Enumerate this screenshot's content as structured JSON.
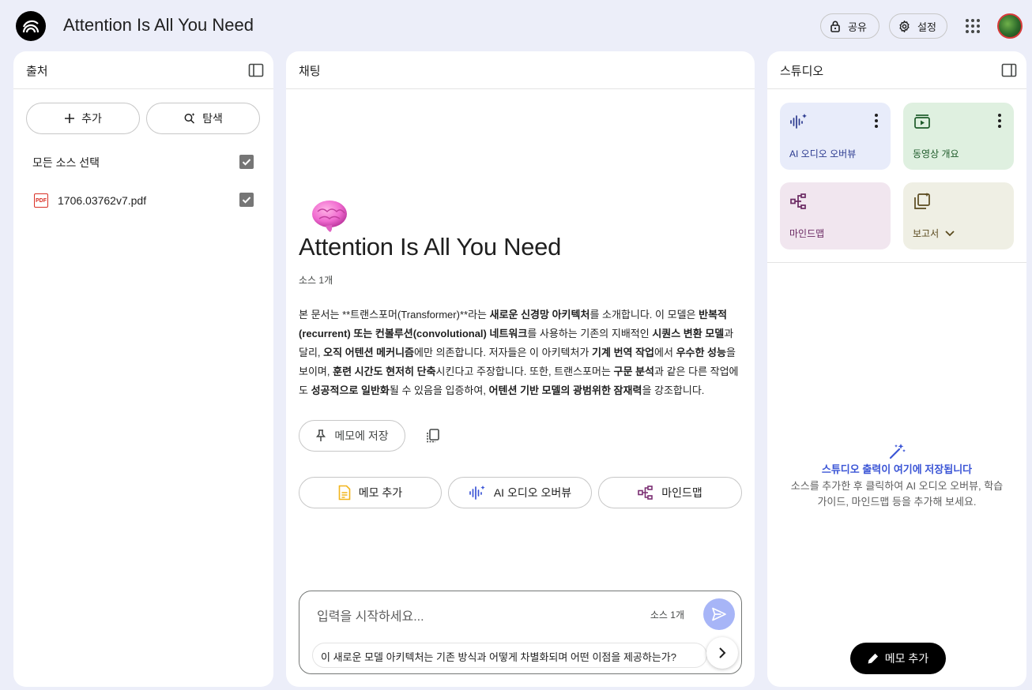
{
  "app": {
    "title": "Attention Is All You Need"
  },
  "header": {
    "share_label": "공유",
    "settings_label": "설정"
  },
  "sources": {
    "title": "출처",
    "add_label": "추가",
    "discover_label": "탐색",
    "select_all_label": "모든 소스 선택",
    "select_all_checked": true,
    "files": [
      {
        "name": "1706.03762v7.pdf",
        "icon": "pdf-icon",
        "checked": true
      }
    ]
  },
  "chat": {
    "title": "채팅",
    "doc_title": "Attention Is All You Need",
    "source_count": "소스 1개",
    "summary": [
      {
        "t": "본 문서는 **트랜스포머(Transformer)**라는 ",
        "b": false
      },
      {
        "t": "새로운 신경망 아키텍처",
        "b": true
      },
      {
        "t": "를 소개합니다. 이 모델은 ",
        "b": false
      },
      {
        "t": "반복적 (recurrent) 또는 컨볼루션(convolutional) 네트워크",
        "b": true
      },
      {
        "t": "를 사용하는 기존의 지배적인 ",
        "b": false
      },
      {
        "t": "시퀀스 변환 모델",
        "b": true
      },
      {
        "t": "과 달리, ",
        "b": false
      },
      {
        "t": "오직 어텐션 메커니즘",
        "b": true
      },
      {
        "t": "에만 의존합니다. 저자들은 이 아키텍처가 ",
        "b": false
      },
      {
        "t": "기계 번역 작업",
        "b": true
      },
      {
        "t": "에서 ",
        "b": false
      },
      {
        "t": "우수한 성능",
        "b": true
      },
      {
        "t": "을 보이며, ",
        "b": false
      },
      {
        "t": "훈련 시간도 현저히 단축",
        "b": true
      },
      {
        "t": "시킨다고 주장합니다. 또한, 트랜스포머는 ",
        "b": false
      },
      {
        "t": "구문 분석",
        "b": true
      },
      {
        "t": "과 같은 다른 작업에도 ",
        "b": false
      },
      {
        "t": "성공적으로 일반화",
        "b": true
      },
      {
        "t": "될 수 있음을 입증하여, ",
        "b": false
      },
      {
        "t": "어텐션 기반 모델의 광범위한 잠재력",
        "b": true
      },
      {
        "t": "을 강조합니다.",
        "b": false
      }
    ],
    "save_memo_label": "메모에 저장",
    "actions": {
      "memo": "메모 추가",
      "audio": "AI 오디오 오버뷰",
      "mindmap": "마인드맵"
    },
    "input": {
      "placeholder": "입력을 시작하세요...",
      "source_count": "소스 1개",
      "suggestion": "이 새로운 모델 아키텍처는 기존 방식과 어떻게 차별화되며 어떤 이점을 제공하는가?"
    }
  },
  "studio": {
    "title": "스튜디오",
    "tiles": {
      "audio": "AI 오디오 오버뷰",
      "video": "동영상 개요",
      "mindmap": "마인드맵",
      "report": "보고서"
    },
    "empty_title": "스튜디오 출력이 여기에 저장됩니다",
    "empty_desc": "소스를 추가한 후 클릭하여 AI 오디오 오버뷰, 학습 가이드, 마인드맵 등을 추가해 보세요.",
    "add_memo_label": "메모 추가"
  },
  "colors": {
    "accent": "#3b55d6",
    "background": "#eceef9",
    "send_button": "#a7b5f7"
  }
}
